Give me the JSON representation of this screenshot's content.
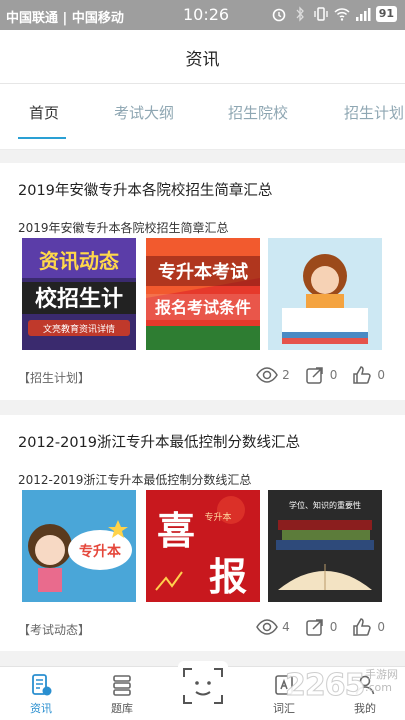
{
  "status_bar": {
    "carrier_1": "中国联通",
    "separator": "|",
    "carrier_2": "中国移动",
    "time": "10:26",
    "battery": "91"
  },
  "header": {
    "title": "资讯"
  },
  "tabs": [
    {
      "label": "首页",
      "active": true
    },
    {
      "label": "考试大纲",
      "active": false
    },
    {
      "label": "招生院校",
      "active": false
    },
    {
      "label": "招生计划",
      "active": false
    }
  ],
  "articles": [
    {
      "title": "2019年安徽专升本各院校招生简章汇总",
      "subtitle": "2019年安徽专升本各院校招生简章汇总",
      "tag": "【招生计划】",
      "views": "2",
      "shares": "0",
      "likes": "0",
      "thumb_texts": {
        "a_line1": "资讯动态",
        "a_line2": "校招生计",
        "a_line3": "文亮教育资讯详情",
        "b_line1": "专升本考试",
        "b_line2": "报名考试条件"
      }
    },
    {
      "title": "2012-2019浙江专升本最低控制分数线汇总",
      "subtitle": "2012-2019浙江专升本最低控制分数线汇总",
      "tag": "【考试动态】",
      "views": "4",
      "shares": "0",
      "likes": "0",
      "thumb_texts": {
        "a_line1": "专升本",
        "b_line1": "喜",
        "b_line2": "报",
        "b_line3": "专升本",
        "c_line1": "学位、知识的重要性"
      }
    }
  ],
  "bottom_nav": [
    {
      "label": "资讯",
      "icon": "news-icon",
      "active": true
    },
    {
      "label": "题库",
      "icon": "database-icon",
      "active": false
    },
    {
      "label": "词汇",
      "icon": "vocab-icon",
      "active": false
    },
    {
      "label": "我的",
      "icon": "user-icon",
      "active": false
    }
  ],
  "watermark": {
    "logo": "2265",
    "domain_suffix": ".com",
    "site": "手游网"
  },
  "colors": {
    "accent": "#2aa0d4",
    "tab_inactive": "#8fa7b3",
    "status_bar": "#9e9e9e"
  }
}
